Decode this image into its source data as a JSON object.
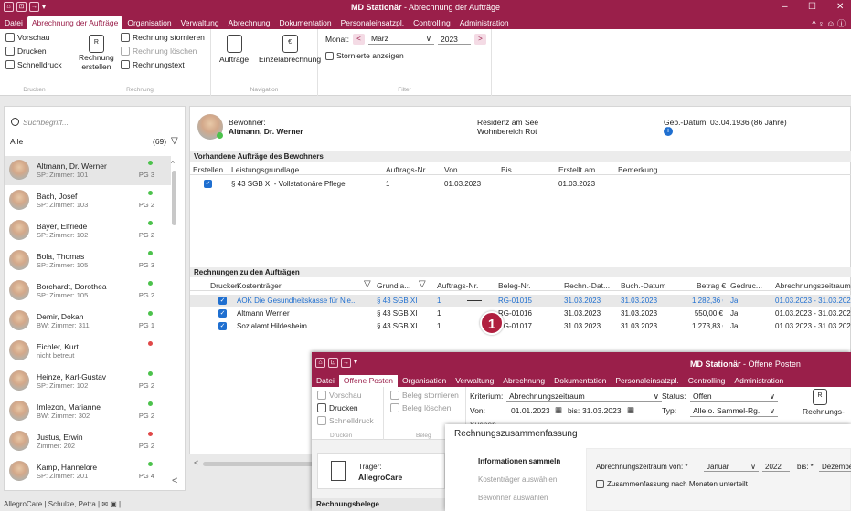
{
  "window": {
    "app": "MD Stationär",
    "title_rest": " - Abrechnung der Aufträge",
    "qat": [
      "⌂",
      "⊡",
      "→",
      "▾"
    ]
  },
  "menu": {
    "items": [
      "Datei",
      "Abrechnung der Aufträge",
      "Organisation",
      "Verwaltung",
      "Abrechnung",
      "Dokumentation",
      "Personaleinsatzpl.",
      "Controlling",
      "Administration"
    ],
    "active_index": 1,
    "right_icons": "^ ♀ ☺ ⓘ"
  },
  "ribbon": {
    "drucken": {
      "label": "Drucken",
      "vorschau": "Vorschau",
      "drucken": "Drucken",
      "schnelldruck": "Schnelldruck"
    },
    "rechnung": {
      "label": "Rechnung",
      "erstellen_line1": "Rechnung",
      "erstellen_line2": "erstellen",
      "stornieren": "Rechnung stornieren",
      "loeschen": "Rechnung löschen",
      "text": "Rechnungstext"
    },
    "navigation": {
      "label": "Navigation",
      "auftraege": "Aufträge",
      "einzel": "Einzelabrechnung"
    },
    "filter": {
      "label": "Filter",
      "monat_label": "Monat:",
      "monat": "März",
      "jahr": "2023",
      "stornierte": "Stornierte anzeigen"
    }
  },
  "left": {
    "search_placeholder": "Suchbegriff...",
    "filter": "Alle",
    "count": "(69)",
    "residents": [
      {
        "name": "Altmann, Dr. Werner",
        "room": "SP: Zimmer: 101",
        "pg": "PG 3",
        "status": "#4cc24c",
        "selected": true
      },
      {
        "name": "Bach, Josef",
        "room": "SP: Zimmer: 103",
        "pg": "PG 2",
        "status": "#4cc24c"
      },
      {
        "name": "Bayer, Elfriede",
        "room": "SP: Zimmer: 102",
        "pg": "PG 2",
        "status": "#4cc24c"
      },
      {
        "name": "Bola, Thomas",
        "room": "SP: Zimmer: 105",
        "pg": "PG 3",
        "status": "#4cc24c"
      },
      {
        "name": "Borchardt, Dorothea",
        "room": "SP: Zimmer: 105",
        "pg": "PG 2",
        "status": "#4cc24c"
      },
      {
        "name": "Demir, Dokan",
        "room": "BW: Zimmer: 311",
        "pg": "PG 1",
        "status": "#4cc24c"
      },
      {
        "name": "Eichler, Kurt",
        "room": "nicht betreut",
        "pg": "",
        "status": "#e04848"
      },
      {
        "name": "Heinze, Karl-Gustav",
        "room": "SP: Zimmer: 102",
        "pg": "PG 2",
        "status": "#4cc24c"
      },
      {
        "name": "Imlezon, Marianne",
        "room": "BW: Zimmer: 302",
        "pg": "PG 2",
        "status": "#4cc24c"
      },
      {
        "name": "Justus, Erwin",
        "room": "Zimmer: 202",
        "pg": "PG 2",
        "status": "#e04848"
      },
      {
        "name": "Kamp, Hannelore",
        "room": "SP: Zimmer: 201",
        "pg": "PG 4",
        "status": "#4cc24c"
      }
    ]
  },
  "header": {
    "bewohner_label": "Bewohner:",
    "bewohner_name": "Altmann, Dr. Werner",
    "residenz": "Residenz am See",
    "wohnbereich": "Wohnbereich Rot",
    "geb": "Geb.-Datum: 03.04.1936 (86 Jahre)"
  },
  "auftraege": {
    "title": "Vorhandene Aufträge des Bewohners",
    "columns": [
      "Erstellen",
      "Leistungsgrundlage",
      "Auftrags-Nr.",
      "Von",
      "Bis",
      "Erstellt am",
      "Bemerkung"
    ],
    "rows": [
      {
        "grundlage": "§ 43 SGB XI - Vollstationäre Pflege",
        "nr": "1",
        "von": "01.03.2023",
        "bis": "",
        "erstellt": "01.03.2023",
        "bemerkung": ""
      }
    ]
  },
  "rechnungen": {
    "title": "Rechnungen zu den Aufträgen",
    "columns": [
      "Drucken",
      "Kostenträger",
      "Grundla...",
      "Auftrags-Nr.",
      "Beleg-Nr.",
      "Rechn.-Dat...",
      "Buch.-Datum",
      "Betrag €",
      "Gedruc...",
      "Abrechnungszeitraum"
    ],
    "rows": [
      {
        "kt": "AOK Die Gesundheitskasse für Nie...",
        "gr": "§ 43 SGB XI",
        "nr": "1",
        "beleg": "RG-01015",
        "rdat": "31.03.2023",
        "bdat": "31.03.2023",
        "betrag": "1.282,36 €",
        "gedr": "Ja",
        "zeit": "01.03.2023 - 31.03.2023",
        "highlight": true
      },
      {
        "kt": "Altmann Werner",
        "gr": "§ 43 SGB XI",
        "nr": "1",
        "beleg": "RG-01016",
        "rdat": "31.03.2023",
        "bdat": "31.03.2023",
        "betrag": "550,00 €",
        "gedr": "Ja",
        "zeit": "01.03.2023 - 31.03.2023"
      },
      {
        "kt": "Sozialamt Hildesheim",
        "gr": "§ 43 SGB XI",
        "nr": "1",
        "beleg": "RG-01017",
        "rdat": "31.03.2023",
        "bdat": "31.03.2023",
        "betrag": "1.273,83 €",
        "gedr": "Ja",
        "zeit": "01.03.2023 - 31.03.2023"
      }
    ]
  },
  "badge": "1",
  "status": {
    "user": "AllegroCare | Schulze, Petra |"
  },
  "window2": {
    "app": "MD Stationär",
    "title_rest": " - Offene Posten",
    "menu": [
      "Datei",
      "Offene Posten",
      "Organisation",
      "Verwaltung",
      "Abrechnung",
      "Dokumentation",
      "Personaleinsatzpl.",
      "Controlling",
      "Administration"
    ],
    "vorschau": "Vorschau",
    "drucken": "Drucken",
    "schnelldruck": "Schnelldruck",
    "beleg_stornieren": "Beleg stornieren",
    "beleg_loeschen": "Beleg löschen",
    "group_drucken": "Drucken",
    "group_beleg": "Beleg",
    "kriterium_label": "Kriterium:",
    "kriterium": "Abrechnungszeitraum",
    "von_label": "Von:",
    "von": "01.01.2023",
    "bis_label": "bis:",
    "bis": "31.03.2023",
    "status_label": "Status:",
    "status": "Offen",
    "typ_label": "Typ:",
    "typ": "Alle o. Sammel-Rg.",
    "suchen": "Suchen",
    "rechnungs": "Rechnungs-",
    "traeger_label": "Träger:",
    "traeger": "AllegroCare",
    "belege": "Rechnungsbelege"
  },
  "dialog": {
    "title": "Rechnungszusammenfassung",
    "steps": [
      "Informationen sammeln",
      "Kostenträger auswählen",
      "Bewohner auswählen"
    ],
    "zeitraum_label": "Abrechnungszeitraum von:",
    "von_monat": "Januar",
    "von_jahr": "2022",
    "bis_label": "bis:",
    "bis_monat": "Dezember",
    "checkbox": "Zusammenfassung nach Monaten unterteilt"
  }
}
